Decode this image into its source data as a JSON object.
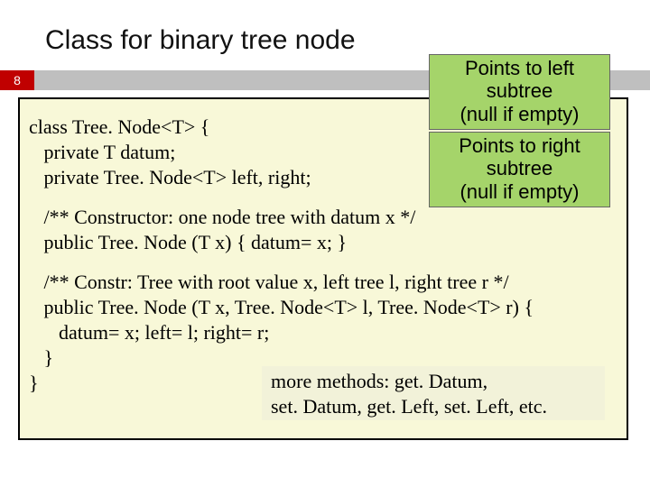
{
  "title": "Class for binary tree node",
  "page": "8",
  "anno1_l1": "Points to left",
  "anno1_l2": "subtree",
  "anno1_l3": "(null if empty)",
  "anno2_l1": "Points to right",
  "anno2_l2": "subtree",
  "anno2_l3": "(null if empty)",
  "code_l1": "class Tree. Node<T> {",
  "code_l2": "   private T datum;",
  "code_l3": "   private Tree. Node<T> left, right;",
  "code_l4": "   /** Constructor: one node tree with datum x */",
  "code_l5": "   public Tree. Node (T x) { datum= x; }",
  "code_l6": "   /** Constr: Tree with root value x, left tree l, right tree r */",
  "code_l7": "   public Tree. Node (T x, Tree. Node<T> l, Tree. Node<T> r) {",
  "code_l8": "      datum= x; left= l; right= r;",
  "code_l9": "   }",
  "code_l10": "}",
  "methods_l1": "more methods: get. Datum,",
  "methods_l2": "set. Datum, get. Left, set. Left, etc."
}
